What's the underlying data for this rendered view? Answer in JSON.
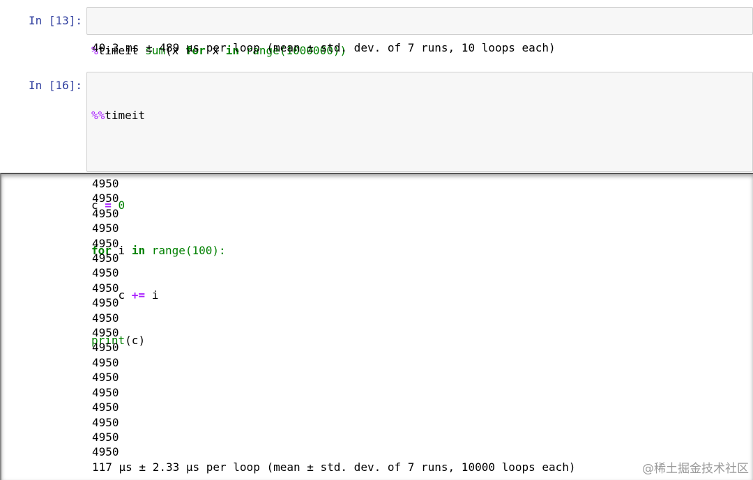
{
  "cells": [
    {
      "prompt": "In [13]:",
      "code": {
        "magic": "%",
        "timeit_word": "timeit",
        "sum_word": "sum",
        "open_paren": "(x ",
        "for_kw": "for",
        "x_word": " x ",
        "in_kw": "in",
        "range_word": " range",
        "arg": "(1000000))"
      },
      "output": "40.3 ms ± 489 µs per loop (mean ± std. dev. of 7 runs, 10 loops each)"
    },
    {
      "prompt": "In [16]:",
      "code": {
        "line1_magic": "%%",
        "line1_word": "timeit",
        "line3_var": "c ",
        "line3_eq": "=",
        "line3_val": " 0",
        "line4_for": "for",
        "line4_mid": " i ",
        "line4_in": "in",
        "line4_range": " range",
        "line4_arg": "(100):",
        "line5_indent": "    c ",
        "line5_op": "+=",
        "line5_rest": " i",
        "line6_print": "print",
        "line6_arg": "(c)"
      },
      "output_lines": [
        "4950",
        "4950",
        "4950",
        "4950",
        "4950",
        "4950",
        "4950",
        "4950",
        "4950",
        "4950",
        "4950",
        "4950",
        "4950",
        "4950",
        "4950",
        "4950",
        "4950",
        "4950",
        "4950"
      ],
      "timing": "117 µs ± 2.33 µs per loop (mean ± std. dev. of 7 runs, 10000 loops each)"
    }
  ],
  "watermark": "@稀土掘金技术社区",
  "colors": {
    "prompt": "#303f9f",
    "magic": "#aa22ff",
    "keyword": "#008000",
    "cell_bg": "#f7f7f7",
    "cell_border": "#cfcfcf"
  }
}
